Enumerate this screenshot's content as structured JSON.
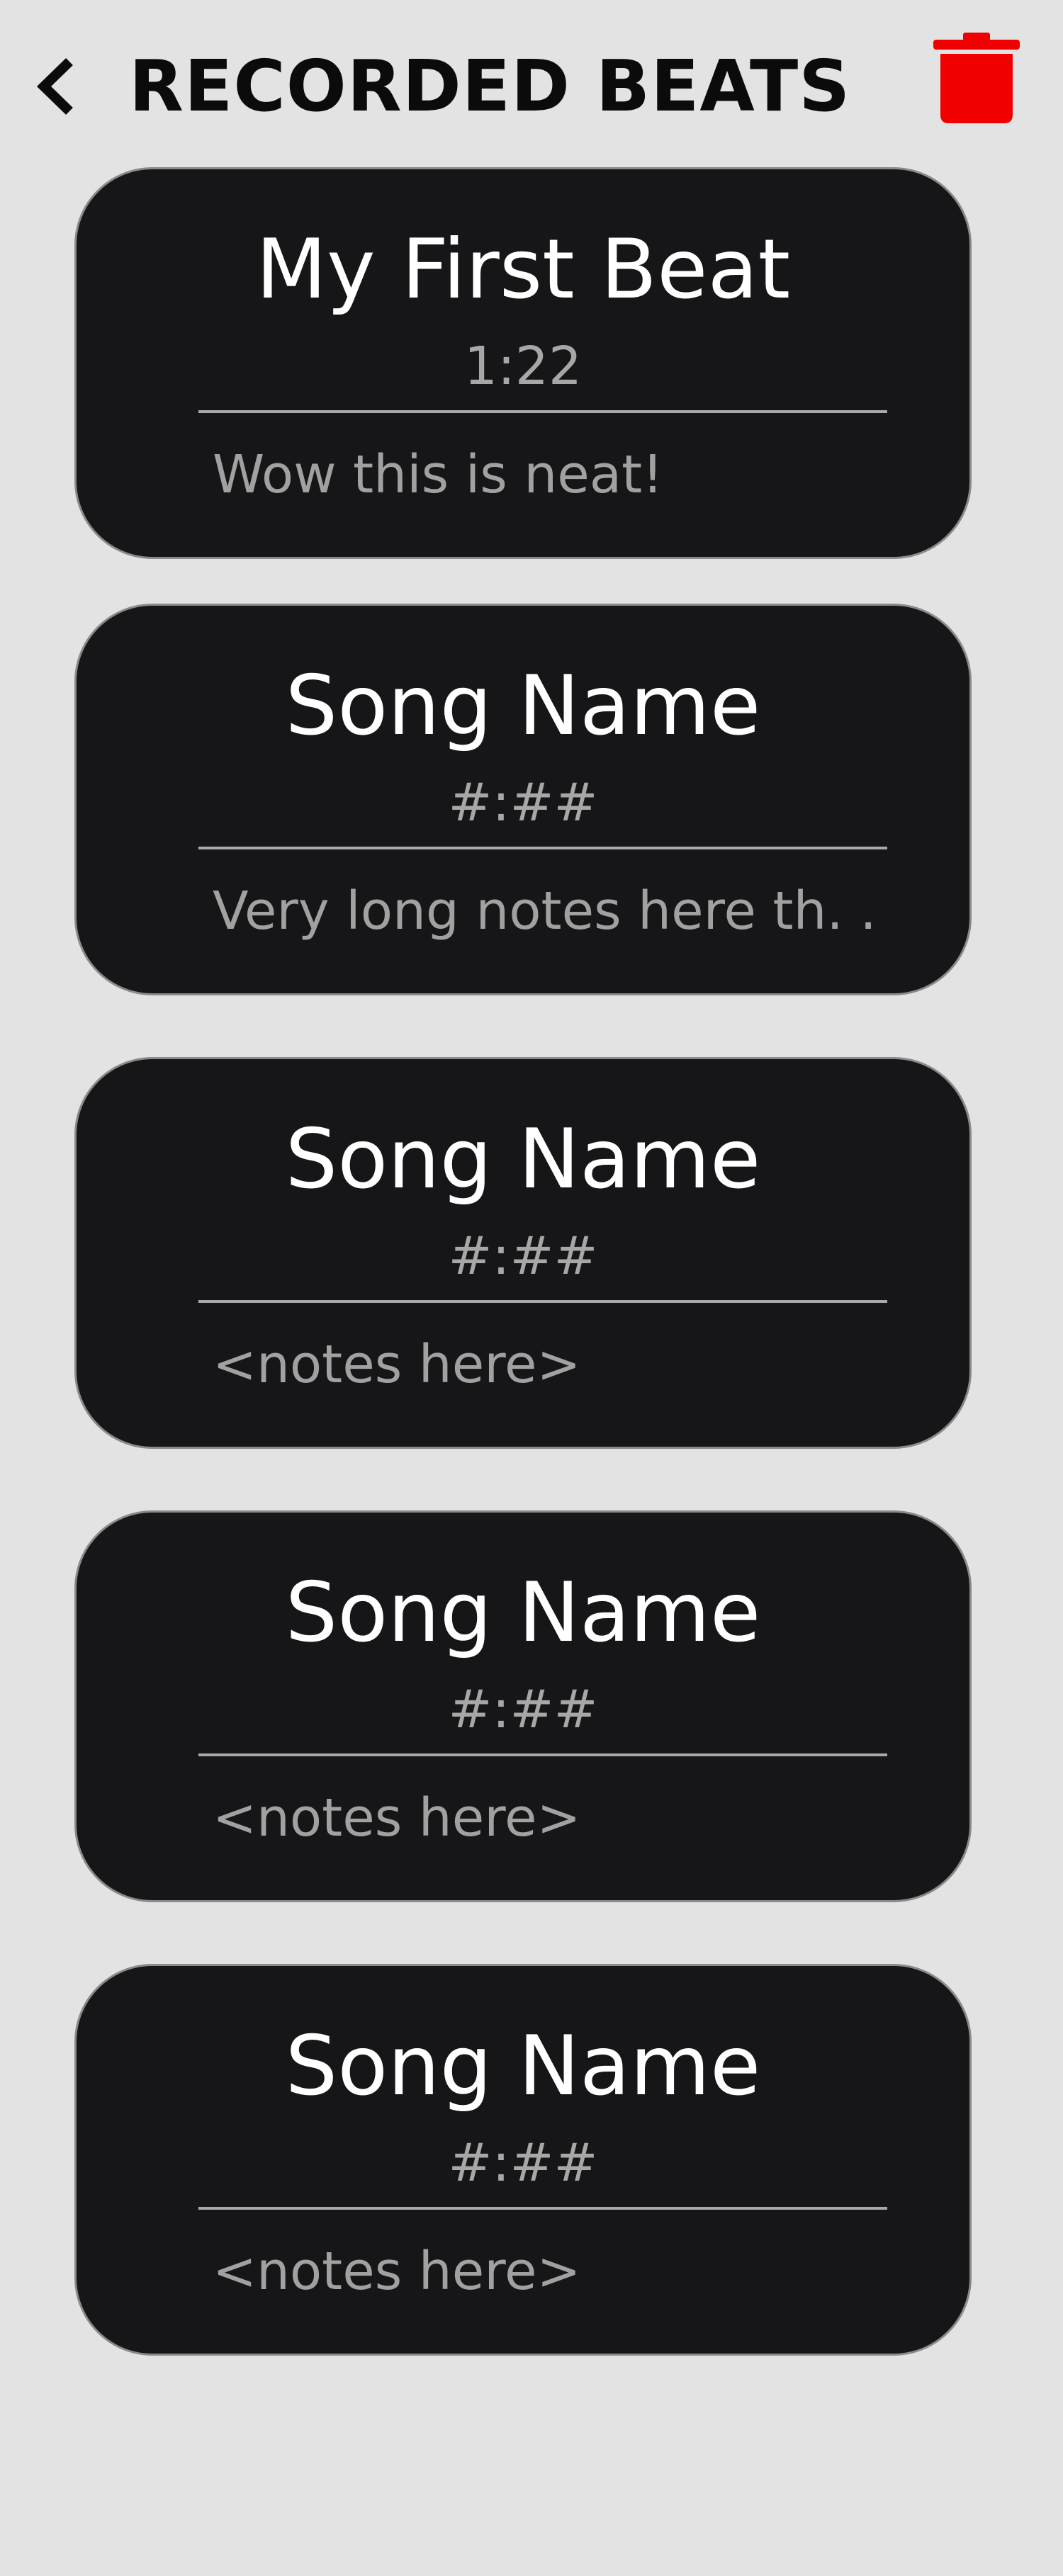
{
  "header": {
    "back_icon": "chevron-left-icon",
    "title": "RECORDED BEATS",
    "trash_icon": "trash-icon",
    "trash_color": "#f00000"
  },
  "beats": [
    {
      "name": "My First Beat",
      "duration": "1:22",
      "notes": "Wow this is neat!"
    },
    {
      "name": "Song Name",
      "duration": "#:##",
      "notes": "Very long notes here th. . ."
    },
    {
      "name": "Song Name",
      "duration": "#:##",
      "notes": "<notes here>"
    },
    {
      "name": "Song Name",
      "duration": "#:##",
      "notes": "<notes here>"
    },
    {
      "name": "Song Name",
      "duration": "#:##",
      "notes": "<notes here>"
    }
  ]
}
